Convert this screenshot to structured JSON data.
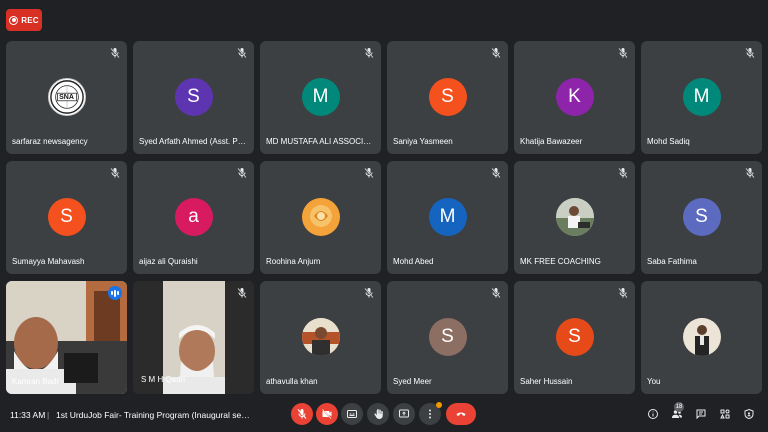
{
  "recording": {
    "label": "REC"
  },
  "participants": [
    {
      "name": "sarfaraz newsagency",
      "type": "logo",
      "initial": "SNA",
      "muted": true
    },
    {
      "name": "Syed Arfath Ahmed (Asst. Prof.)",
      "type": "initial",
      "initial": "S",
      "color": "#5e35b1",
      "muted": true
    },
    {
      "name": "MD MUSTAFA ALI ASSOCIATE ...",
      "type": "initial",
      "initial": "M",
      "color": "#00897b",
      "muted": true
    },
    {
      "name": "Saniya Yasmeen",
      "type": "initial",
      "initial": "S",
      "color": "#f4511e",
      "muted": true
    },
    {
      "name": "Khatija Bawazeer",
      "type": "initial",
      "initial": "K",
      "color": "#8e24aa",
      "muted": true
    },
    {
      "name": "Mohd Sadiq",
      "type": "initial",
      "initial": "M",
      "color": "#00897b",
      "muted": true
    },
    {
      "name": "Sumayya Mahavash",
      "type": "initial",
      "initial": "S",
      "color": "#f4511e",
      "muted": true
    },
    {
      "name": "aijaz ali Quraishi",
      "type": "initial",
      "initial": "a",
      "color": "#d81b60",
      "muted": true
    },
    {
      "name": "Roohina Anjum",
      "type": "photo",
      "photo": "rose",
      "muted": true
    },
    {
      "name": "Mohd Abed",
      "type": "initial",
      "initial": "M",
      "color": "#1565c0",
      "muted": true
    },
    {
      "name": "MK FREE COACHING",
      "type": "photo",
      "photo": "coach",
      "muted": true
    },
    {
      "name": "Saba Fathima",
      "type": "initial",
      "initial": "S",
      "color": "#5c6bc0",
      "muted": true
    },
    {
      "name": "Kamran Badr",
      "type": "video",
      "video": "kamran",
      "muted": false,
      "speaking": true
    },
    {
      "name": "S M H Qadri",
      "type": "video",
      "video": "qadri",
      "muted": true
    },
    {
      "name": "athavulla khan",
      "type": "photo",
      "photo": "man",
      "muted": true
    },
    {
      "name": "Syed Meer",
      "type": "initial",
      "initial": "S",
      "color": "#8d6e63",
      "muted": true
    },
    {
      "name": "Saher Hussain",
      "type": "initial",
      "initial": "S",
      "color": "#e64a19",
      "muted": true
    },
    {
      "name": "You",
      "type": "photo",
      "photo": "you",
      "muted": false
    }
  ],
  "bottom_bar": {
    "time": "11:33 AM",
    "separator": "|",
    "meeting_title": "1st UrduJob Fair- Training Program (Inaugural ses...",
    "people_count": "18"
  },
  "colors": {
    "background": "#202124",
    "tile": "#3c4043",
    "danger": "#ea4335",
    "accent": "#8ab4f8"
  },
  "controls": [
    {
      "name": "mic-off-button",
      "icon": "mic-off-icon"
    },
    {
      "name": "camera-off-button",
      "icon": "videocam-off-icon"
    },
    {
      "name": "captions-button",
      "icon": "closed-captions-icon"
    },
    {
      "name": "raise-hand-button",
      "icon": "hand-icon"
    },
    {
      "name": "present-button",
      "icon": "present-icon"
    },
    {
      "name": "more-options-button",
      "icon": "more-vert-icon"
    },
    {
      "name": "leave-call-button",
      "icon": "call-end-icon"
    }
  ],
  "right_tools": [
    {
      "name": "meeting-info-button",
      "icon": "info-icon"
    },
    {
      "name": "people-button",
      "icon": "people-icon"
    },
    {
      "name": "chat-button",
      "icon": "chat-icon"
    },
    {
      "name": "activities-button",
      "icon": "activities-icon"
    },
    {
      "name": "host-controls-button",
      "icon": "shield-icon"
    }
  ]
}
